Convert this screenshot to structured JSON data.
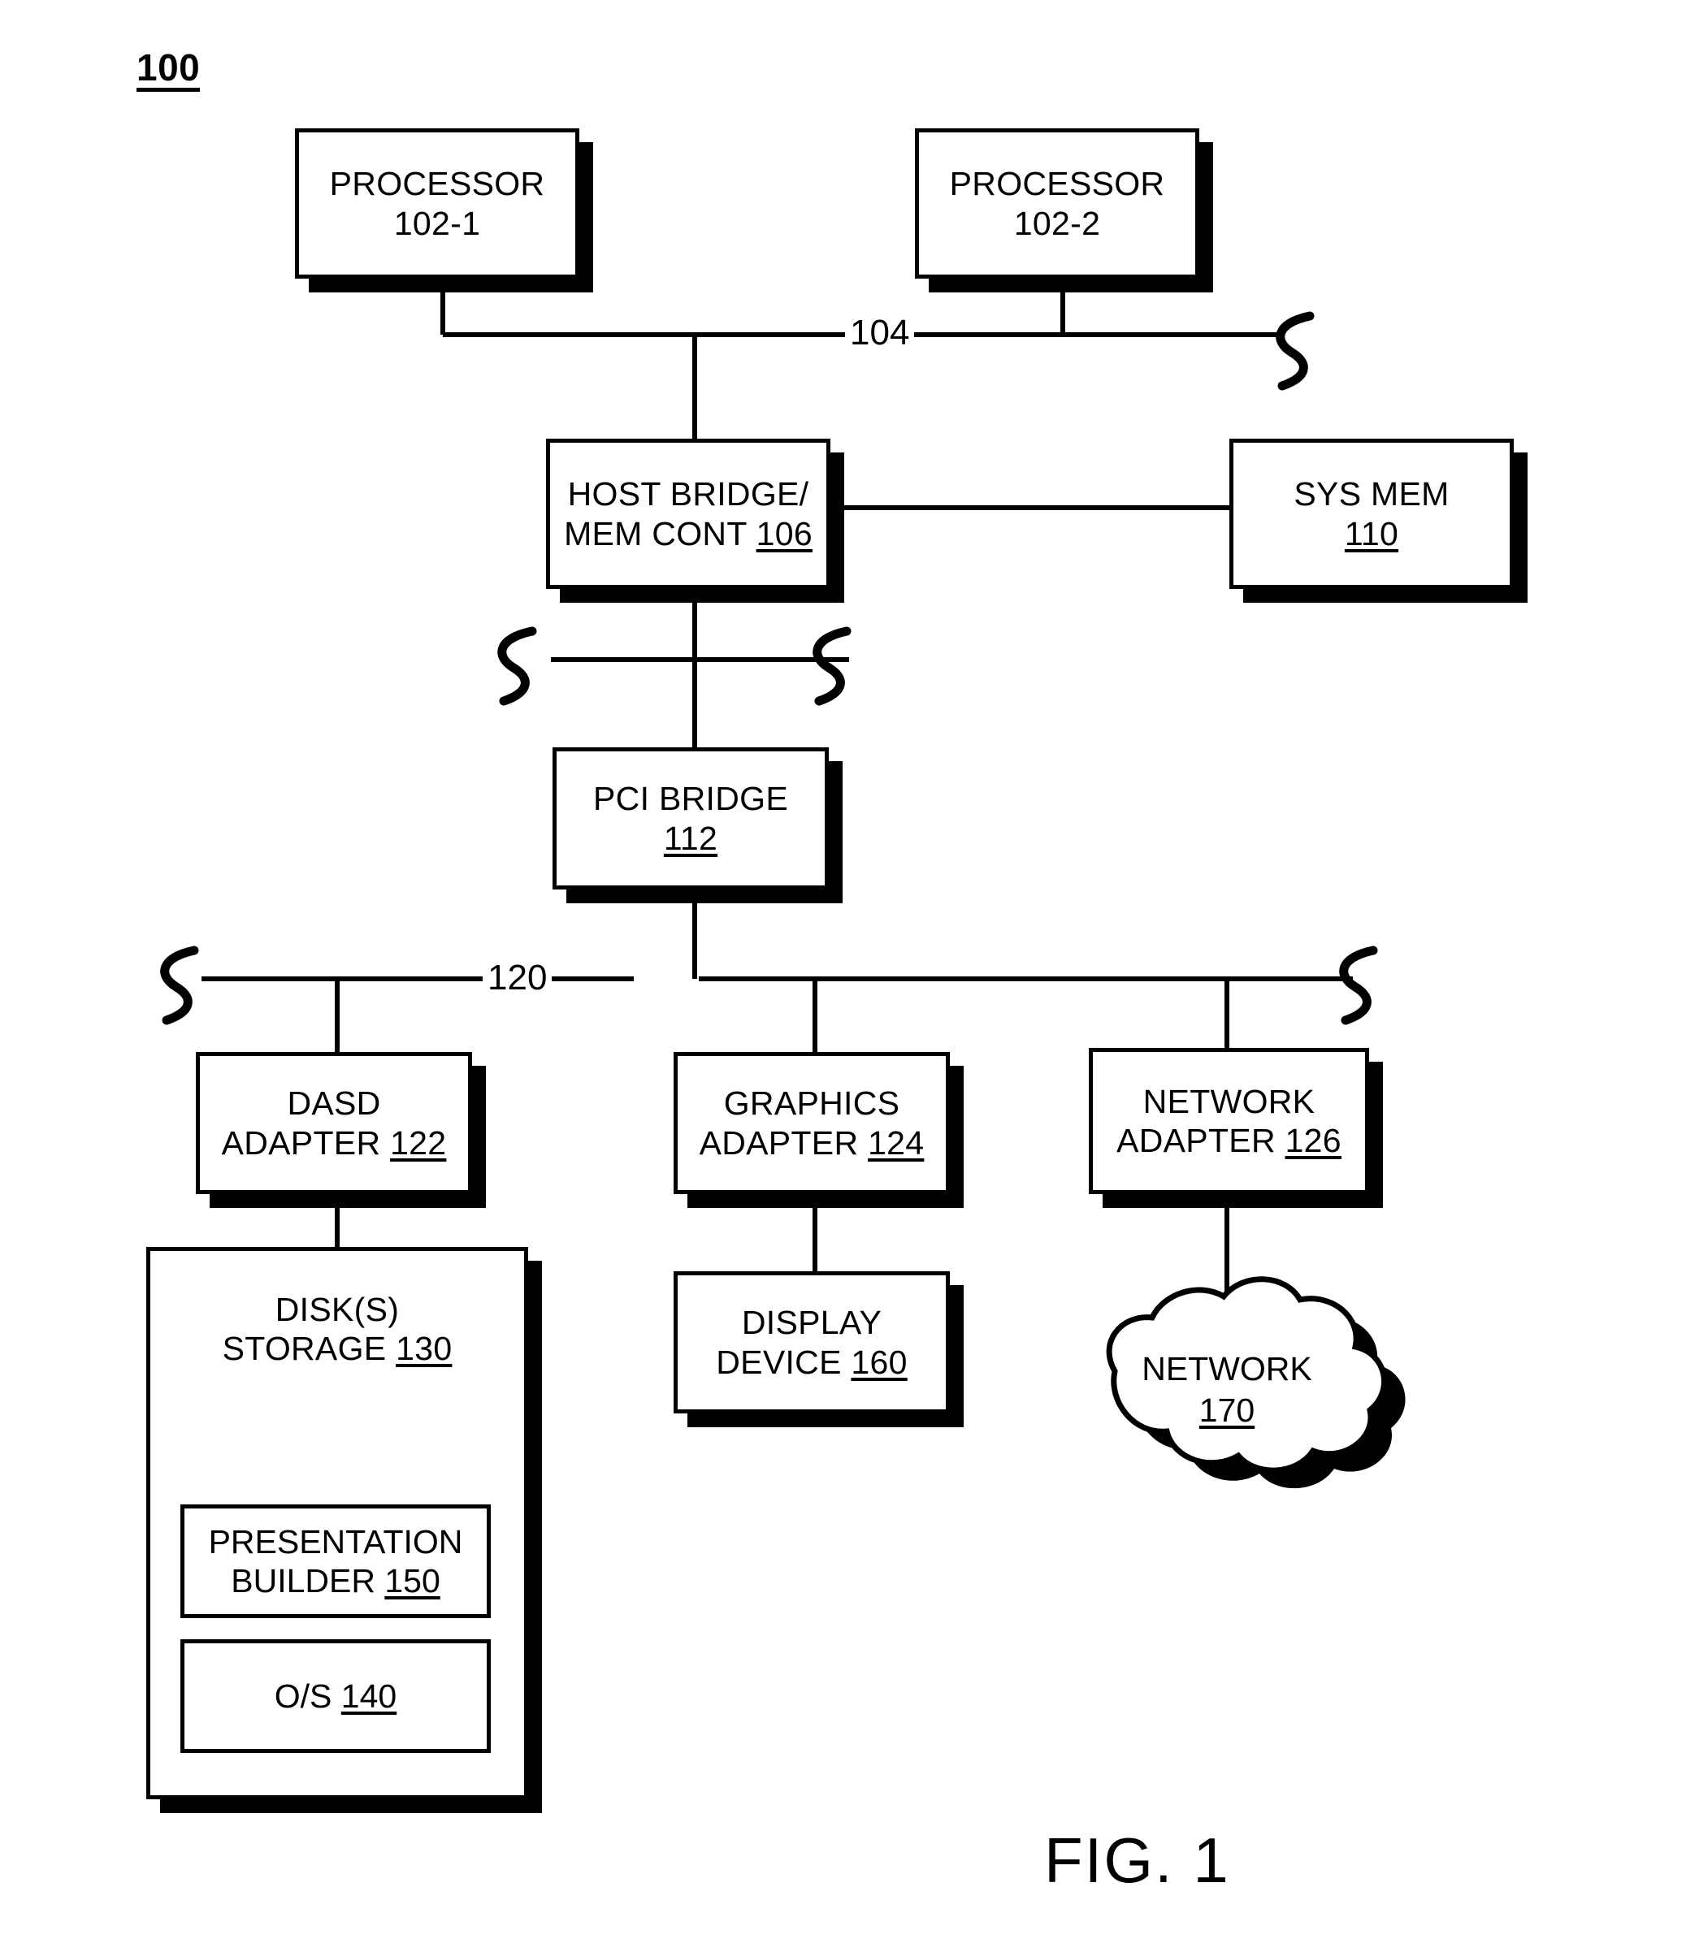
{
  "figure": {
    "number": "100",
    "caption": "FIG. 1"
  },
  "nodes": {
    "processor_1": {
      "line1": "PROCESSOR",
      "line2": "102-1"
    },
    "processor_2": {
      "line1": "PROCESSOR",
      "line2": "102-2"
    },
    "host_bridge": {
      "line1": "HOST BRIDGE/",
      "line2": "MEM CONT ",
      "ref": "106"
    },
    "sys_mem": {
      "line1": "SYS MEM",
      "ref": "110"
    },
    "pci_bridge": {
      "line1": "PCI BRIDGE",
      "ref": "112"
    },
    "dasd_adapter": {
      "line1": "DASD",
      "line2": "ADAPTER ",
      "ref": "122"
    },
    "graphics_adapter": {
      "line1": "GRAPHICS",
      "line2": "ADAPTER ",
      "ref": "124"
    },
    "network_adapter": {
      "line1": "NETWORK",
      "line2": "ADAPTER ",
      "ref": "126"
    },
    "disk_storage": {
      "line1": "DISK(S)",
      "line2": "STORAGE ",
      "ref": "130"
    },
    "display_device": {
      "line1": "DISPLAY",
      "line2": "DEVICE ",
      "ref": "160"
    },
    "presentation_builder": {
      "line1": "PRESENTATION",
      "line2": "BUILDER ",
      "ref": "150"
    },
    "operating_system": {
      "line1": "O/S ",
      "ref": "140"
    },
    "network_cloud": {
      "line1": "NETWORK",
      "ref": "170"
    }
  },
  "buses": {
    "system_bus": {
      "label": "104"
    },
    "pci_bus": {
      "label": "120"
    }
  },
  "colors": {
    "stroke": "#000000",
    "background": "#ffffff",
    "shadow": "#000000"
  }
}
